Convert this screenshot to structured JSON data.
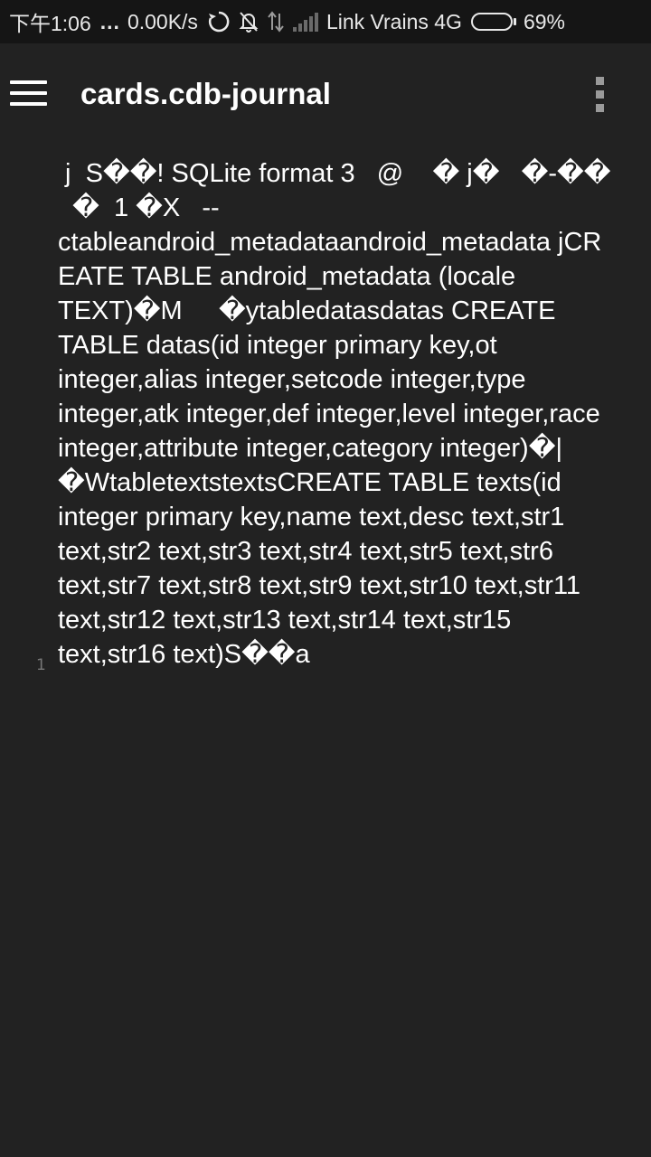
{
  "status_bar": {
    "time": "下午1:06",
    "more": "...",
    "speed": "0.00K/s",
    "carrier": "Link  Vrains 4G",
    "battery_percent": "69%",
    "battery_level": 0.69
  },
  "toolbar": {
    "title": "cards.cdb-journal"
  },
  "editor": {
    "line_number": "1",
    "lines": [
      " j  S��! SQLite format 3   @    � j�   �-��",
      "  �  1 �X   --",
      "ctableandroid_metadataandroid_metadata jCR",
      "EATE TABLE android_metadata (locale",
      "TEXT)�M     �ytabledatasdatas CREATE",
      "TABLE datas(id integer primary key,ot",
      "integer,alias integer,setcode integer,type",
      "integer,atk integer,def integer,level integer,race",
      "integer,attribute integer,category integer)�|",
      "�WtabletextstextsCREATE TABLE texts(id",
      "integer primary key,name text,desc text,str1",
      "text,str2 text,str3 text,str4 text,str5 text,str6",
      "text,str7 text,str8 text,str9 text,str10 text,str11",
      "text,str12 text,str13 text,str14 text,str15",
      "text,str16 text)S��a"
    ]
  }
}
